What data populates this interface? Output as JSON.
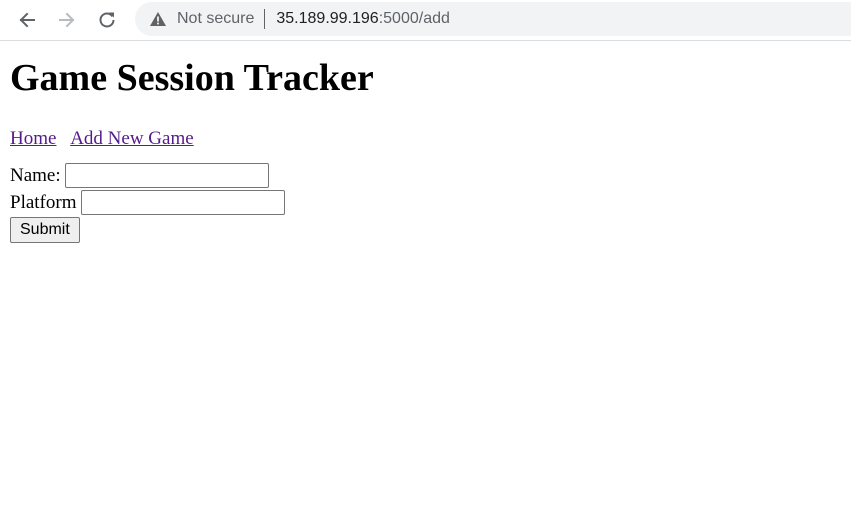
{
  "browser": {
    "security_label": "Not secure",
    "url_host": "35.189.99.196",
    "url_path": ":5000/add",
    "icons": {
      "back": "arrow-left-icon",
      "forward": "arrow-right-icon",
      "reload": "reload-icon",
      "security": "warning-triangle-icon"
    },
    "forward_enabled": false
  },
  "page": {
    "title": "Game Session Tracker",
    "nav": {
      "home_label": "Home",
      "add_label": "Add New Game"
    },
    "form": {
      "name_label": "Name:",
      "name_value": "",
      "platform_label": "Platform",
      "platform_value": "",
      "submit_label": "Submit"
    }
  },
  "colors": {
    "link_visited": "#551a8b",
    "omnibox_bg": "#f1f3f4"
  }
}
